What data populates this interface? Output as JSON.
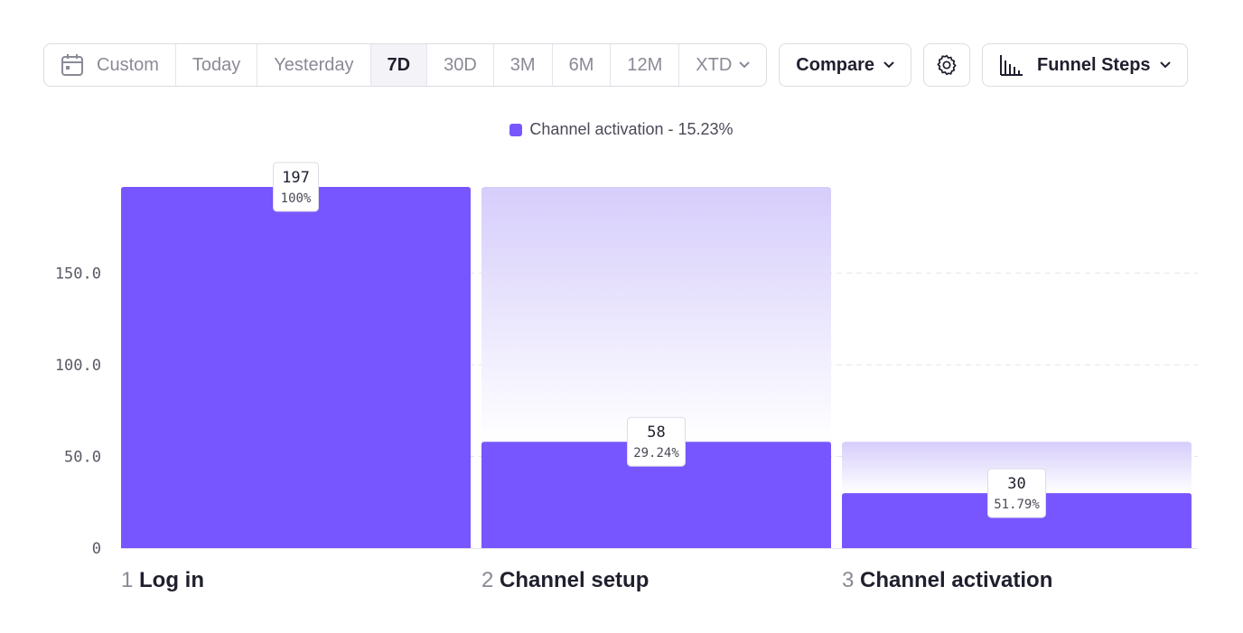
{
  "toolbar": {
    "date_range": {
      "items": [
        {
          "label": "Custom",
          "icon": "calendar-icon"
        },
        {
          "label": "Today"
        },
        {
          "label": "Yesterday"
        },
        {
          "label": "7D",
          "active": true
        },
        {
          "label": "30D"
        },
        {
          "label": "3M"
        },
        {
          "label": "6M"
        },
        {
          "label": "12M"
        },
        {
          "label": "XTD",
          "icon": "chevron-down-icon"
        }
      ]
    },
    "compare_label": "Compare",
    "settings_icon": "gear-icon",
    "view_label": "Funnel Steps",
    "view_icon": "bar-chart-icon"
  },
  "colors": {
    "bar": "#7856ff",
    "bar_ghost": "#d9d2fb",
    "grid": "#e4e4ea"
  },
  "chart_data": {
    "type": "bar",
    "legend": {
      "label": "Channel activation - 15.23%",
      "placement": "top-center"
    },
    "categories": [
      "Log in",
      "Channel setup",
      "Channel activation"
    ],
    "step_numbers": [
      "1",
      "2",
      "3"
    ],
    "values": [
      197,
      58,
      30
    ],
    "percent_labels": [
      "100%",
      "29.24%",
      "51.79%"
    ],
    "previous_step_values": [
      null,
      197,
      58
    ],
    "count_labels": [
      "197",
      "58",
      "30"
    ],
    "y_ticks": [
      0,
      50,
      100,
      150
    ],
    "y_tick_labels": [
      "0",
      "50.0",
      "100.0",
      "150.0"
    ],
    "ylim": [
      0,
      197
    ],
    "grid": true
  }
}
